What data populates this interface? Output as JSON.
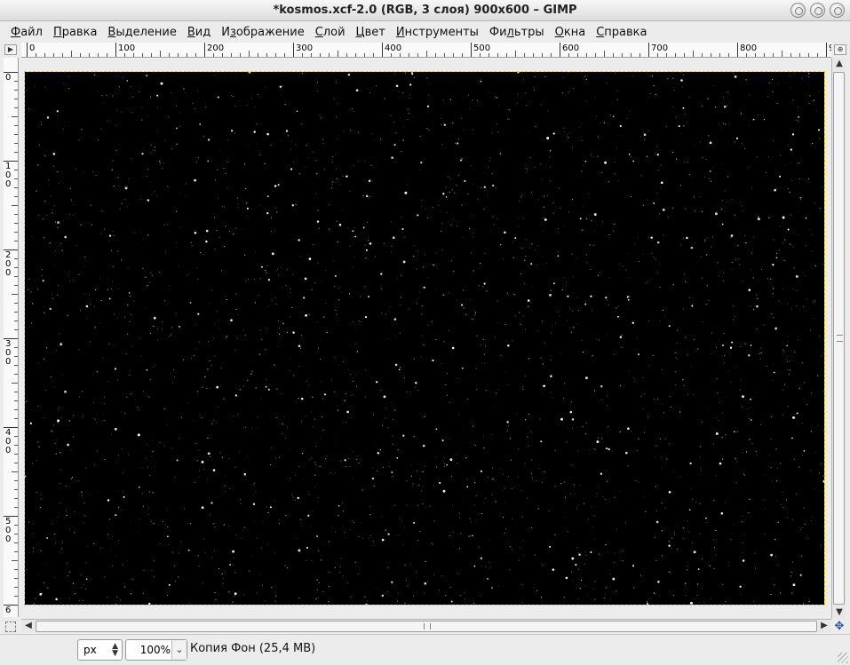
{
  "window": {
    "title": "*kosmos.xcf-2.0 (RGB, 3 слоя) 900x600 – GIMP"
  },
  "menubar": [
    {
      "pre": "",
      "u": "Ф",
      "post": "айл"
    },
    {
      "pre": "",
      "u": "П",
      "post": "равка"
    },
    {
      "pre": "",
      "u": "В",
      "post": "ыделение"
    },
    {
      "pre": "",
      "u": "В",
      "post": "ид"
    },
    {
      "pre": "И",
      "u": "з",
      "post": "ображение"
    },
    {
      "pre": "",
      "u": "С",
      "post": "лой"
    },
    {
      "pre": "",
      "u": "Ц",
      "post": "вет"
    },
    {
      "pre": "",
      "u": "И",
      "post": "нструменты"
    },
    {
      "pre": "Фи",
      "u": "л",
      "post": "ьтры"
    },
    {
      "pre": "",
      "u": "О",
      "post": "кна"
    },
    {
      "pre": "",
      "u": "С",
      "post": "правка"
    }
  ],
  "ruler": {
    "horizontal_labels": [
      "0",
      "100",
      "200",
      "300",
      "400",
      "500",
      "600",
      "700",
      "800",
      "9"
    ],
    "vertical_labels": [
      "0",
      "100",
      "200",
      "300",
      "400",
      "500",
      "6"
    ]
  },
  "canvas": {
    "width": 900,
    "height": 600,
    "background": "#000000",
    "star_color": "#ffffff",
    "selection_color": "#f4d000"
  },
  "statusbar": {
    "unit": "px",
    "zoom": "100%",
    "layer_info": "Копия Фон (25,4 MB)"
  }
}
